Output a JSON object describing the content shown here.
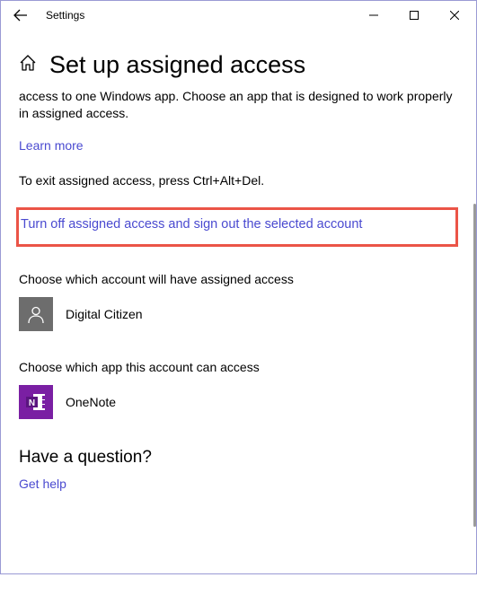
{
  "titlebar": {
    "app_name": "Settings"
  },
  "heading": "Set up assigned access",
  "intro_text": "access to one Windows app. Choose an app that is designed to work properly in assigned access.",
  "learn_more": "Learn more",
  "exit_text": "To exit assigned access, press Ctrl+Alt+Del.",
  "turn_off_link": "Turn off assigned access and sign out the selected account",
  "account_section_label": "Choose which account will have assigned access",
  "account_name": "Digital Citizen",
  "app_section_label": "Choose which app this account can access",
  "app_name": "OneNote",
  "question_heading": "Have a question?",
  "get_help": "Get help"
}
